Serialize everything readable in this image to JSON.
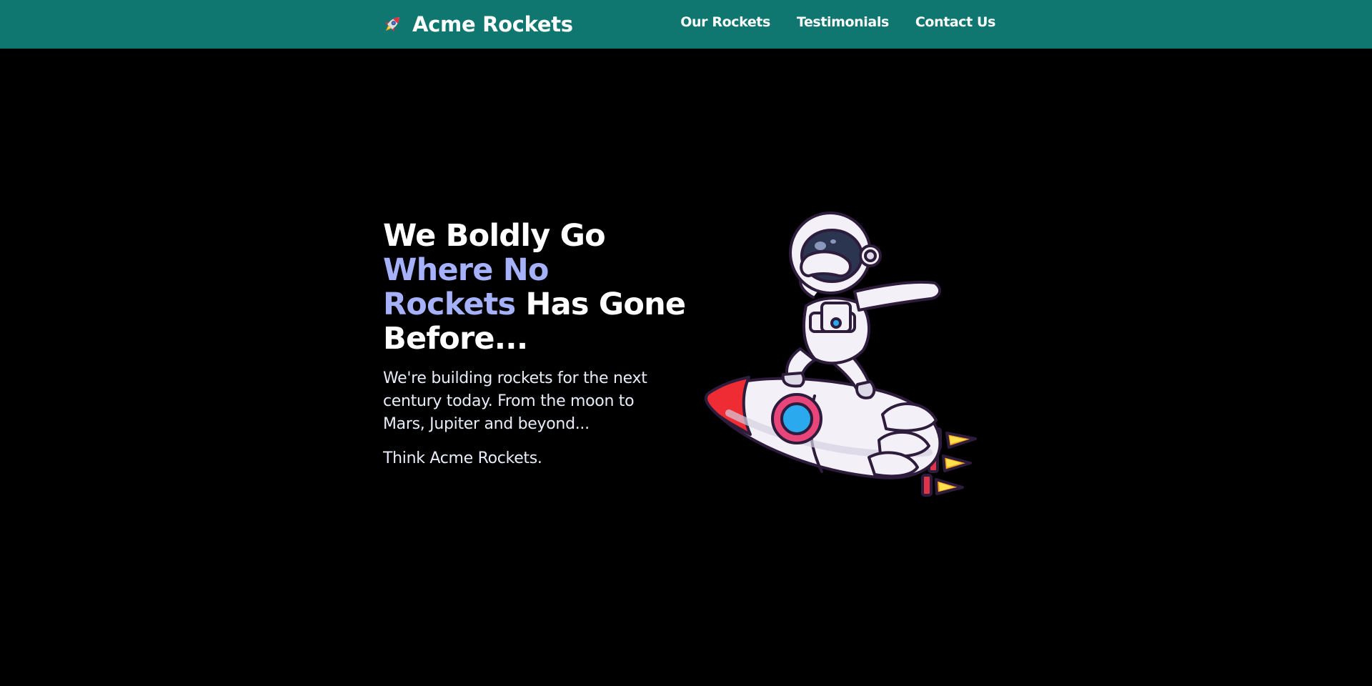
{
  "header": {
    "brand_icon": "rocket-icon",
    "brand_name": "Acme Rockets",
    "nav": [
      {
        "label": "Our Rockets"
      },
      {
        "label": "Testimonials"
      },
      {
        "label": "Contact Us"
      }
    ]
  },
  "hero": {
    "headline_part1": "We Boldly Go",
    "headline_accent": "Where No Rockets",
    "headline_part2": "Has Gone Before...",
    "description": "We're building rockets for the next century today. From the moon to Mars, Jupiter and beyond...",
    "tagline": "Think Acme Rockets.",
    "illustration": "astronaut-riding-rocket-illustration"
  },
  "colors": {
    "header_bg": "#0f7670",
    "page_bg": "#000000",
    "accent": "#a6b1fb",
    "text": "#ffffff"
  }
}
